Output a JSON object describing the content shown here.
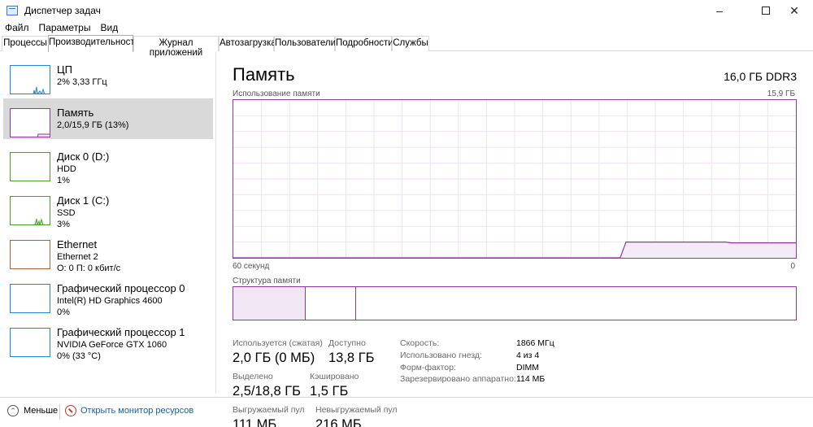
{
  "window": {
    "title": "Диспетчер задач",
    "minimize_icon": "minimize-icon",
    "maximize_icon": "maximize-icon",
    "close_icon": "close-icon"
  },
  "menu": [
    "Файл",
    "Параметры",
    "Вид"
  ],
  "tabs": [
    {
      "label": "Процессы",
      "active": false
    },
    {
      "label": "Производительность",
      "active": true
    },
    {
      "label": "Журнал приложений",
      "active": false
    },
    {
      "label": "Автозагрузка",
      "active": false
    },
    {
      "label": "Пользователи",
      "active": false
    },
    {
      "label": "Подробности",
      "active": false
    },
    {
      "label": "Службы",
      "active": false
    }
  ],
  "sidebar": {
    "items": [
      {
        "name": "ЦП",
        "line1": "2% 3,33 ГГц",
        "line2": "",
        "color": "#1a8ad4",
        "selected": false
      },
      {
        "name": "Память",
        "line1": "2,0/15,9 ГБ (13%)",
        "line2": "",
        "color": "#8b3a9e",
        "selected": true
      },
      {
        "name": "Диск 0 (D:)",
        "line1": "HDD",
        "line2": "1%",
        "color": "#4e9a2b",
        "selected": false
      },
      {
        "name": "Диск 1 (C:)",
        "line1": "SSD",
        "line2": "3%",
        "color": "#4e9a2b",
        "selected": false
      },
      {
        "name": "Ethernet",
        "line1": "Ethernet 2",
        "line2": "О: 0 П: 0 кбит/с",
        "color": "#a7603a",
        "selected": false
      },
      {
        "name": "Графический процессор 0",
        "line1": "Intel(R) HD Graphics 4600",
        "line2": "0%",
        "color": "#1a8ad4",
        "selected": false
      },
      {
        "name": "Графический процессор 1",
        "line1": "NVIDIA GeForce GTX 1060",
        "line2": "0% (33 °C)",
        "color": "#1a8ad4",
        "selected": false
      }
    ]
  },
  "main": {
    "title": "Память",
    "spec": "16,0 ГБ DDR3",
    "graph_label": "Использование памяти",
    "graph_max": "15,9 ГБ",
    "graph_left": "60 секунд",
    "graph_right": "0",
    "usage_history_percent": [
      0,
      0,
      0,
      0,
      0,
      0,
      0,
      0,
      0,
      0,
      0,
      0,
      0,
      0,
      0,
      0,
      0,
      0,
      0,
      0,
      0,
      0,
      0,
      0,
      0,
      0,
      0,
      0,
      0,
      0,
      0,
      0,
      0,
      0,
      0,
      0,
      0,
      0,
      0,
      0,
      0,
      0,
      0,
      0,
      0,
      0,
      0,
      0,
      0,
      0,
      0,
      0,
      0,
      0,
      0,
      0,
      0,
      0,
      0,
      0,
      0,
      0,
      0,
      0,
      0,
      0,
      0,
      10,
      10,
      10,
      10,
      10,
      10,
      10,
      10,
      10,
      10,
      10,
      10,
      10,
      10,
      10,
      10,
      10,
      10,
      9.5,
      9.5,
      9.5,
      9.5,
      9.5,
      9.5,
      9.5,
      9.5,
      9.5,
      9.5,
      9.5,
      9.5
    ],
    "structure_label": "Структура памяти",
    "structure_segments_percent": [
      12.8,
      9.0,
      78.2
    ],
    "stats": {
      "in_use_label": "Используется (сжатая)",
      "in_use": "2,0 ГБ (0 МБ)",
      "available_label": "Доступно",
      "available": "13,8 ГБ",
      "committed_label": "Выделено",
      "committed": "2,5/18,8 ГБ",
      "cached_label": "Кэшировано",
      "cached": "1,5 ГБ",
      "paged_label": "Выгружаемый пул",
      "paged": "111 МБ",
      "nonpaged_label": "Невыгружаемый пул",
      "nonpaged": "216 МБ"
    },
    "specs": [
      {
        "label": "Скорость:",
        "value": "1866 МГц"
      },
      {
        "label": "Использовано гнезд:",
        "value": "4 из 4"
      },
      {
        "label": "Форм-фактор:",
        "value": "DIMM"
      },
      {
        "label": "Зарезервировано аппаратно:",
        "value": "114 МБ"
      }
    ]
  },
  "footer": {
    "less": "Меньше",
    "monitor": "Открыть монитор ресурсов"
  }
}
